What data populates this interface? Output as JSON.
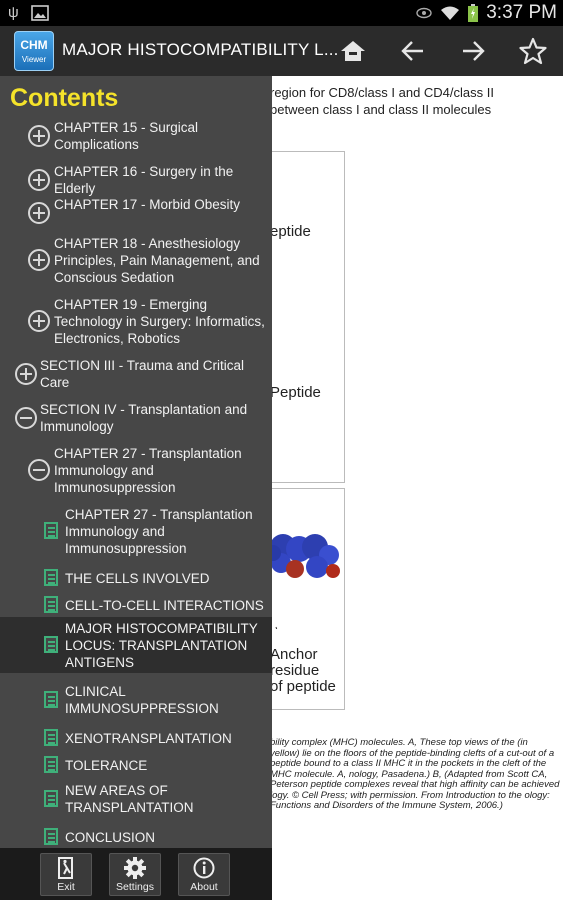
{
  "status_bar": {
    "time": "3:37 PM"
  },
  "app": {
    "logo_top": "CHM",
    "logo_bottom": "Viewer",
    "title": "MAJOR HISTOCOMPATIBILITY L..."
  },
  "document": {
    "lines": [
      "region for CD8/class I and CD4/class II",
      "between class I and class II molecules"
    ],
    "labels": [
      "eptide",
      "Peptide",
      "Anchor",
      "residue",
      "of peptide"
    ],
    "caption": "bility complex (MHC) molecules. A, These top views of the (in yellow) lie on the floors of the peptide-binding clefts of a cut-out of a peptide bound to a class II MHC it in the pockets in the cleft of the MHC molecule. A, nology, Pasadena.) B, (Adapted from Scott CA, Peterson peptide complexes reveal that high affinity can be achieved logy. © Cell Press; with permission. From Introduction to the ology: Functions and Disorders of the Immune System, 2006.)"
  },
  "drawer": {
    "title": "Contents",
    "items": [
      {
        "label": "CHAPTER 15 - Surgical Complications",
        "kind": "plus"
      },
      {
        "label": "CHAPTER 16 - Surgery in the Elderly",
        "kind": "plus"
      },
      {
        "label": "CHAPTER 17 - Morbid Obesity",
        "kind": "plus"
      },
      {
        "label": "CHAPTER 18 - Anesthesiology Principles, Pain Management, and Conscious Sedation",
        "kind": "plus"
      },
      {
        "label": "CHAPTER 19 - Emerging Technology in Surgery: Informatics, Electronics, Robotics",
        "kind": "plus"
      },
      {
        "label": "SECTION III - Trauma and Critical Care",
        "kind": "plus"
      },
      {
        "label": "SECTION IV - Transplantation and Immunology",
        "kind": "minus"
      },
      {
        "label": "CHAPTER 27 - Transplantation Immunology and Immunosuppression",
        "kind": "minus"
      },
      {
        "label": "CHAPTER 27 - Transplantation Immunology and Immunosuppression",
        "kind": "doc"
      },
      {
        "label": "THE CELLS INVOLVED",
        "kind": "doc"
      },
      {
        "label": "CELL-TO-CELL INTERACTIONS",
        "kind": "doc"
      },
      {
        "label": "MAJOR HISTOCOMPATIBILITY LOCUS: TRANSPLANTATION ANTIGENS",
        "kind": "doc",
        "selected": true
      },
      {
        "label": "CLINICAL IMMUNOSUPPRESSION",
        "kind": "doc"
      },
      {
        "label": "XENOTRANSPLANTATION",
        "kind": "doc"
      },
      {
        "label": "TOLERANCE",
        "kind": "doc"
      },
      {
        "label": "NEW AREAS OF TRANSPLANTATION",
        "kind": "doc"
      },
      {
        "label": "CONCLUSION",
        "kind": "doc"
      }
    ]
  },
  "bottom_bar": {
    "exit": "Exit",
    "settings": "Settings",
    "about": "About"
  }
}
